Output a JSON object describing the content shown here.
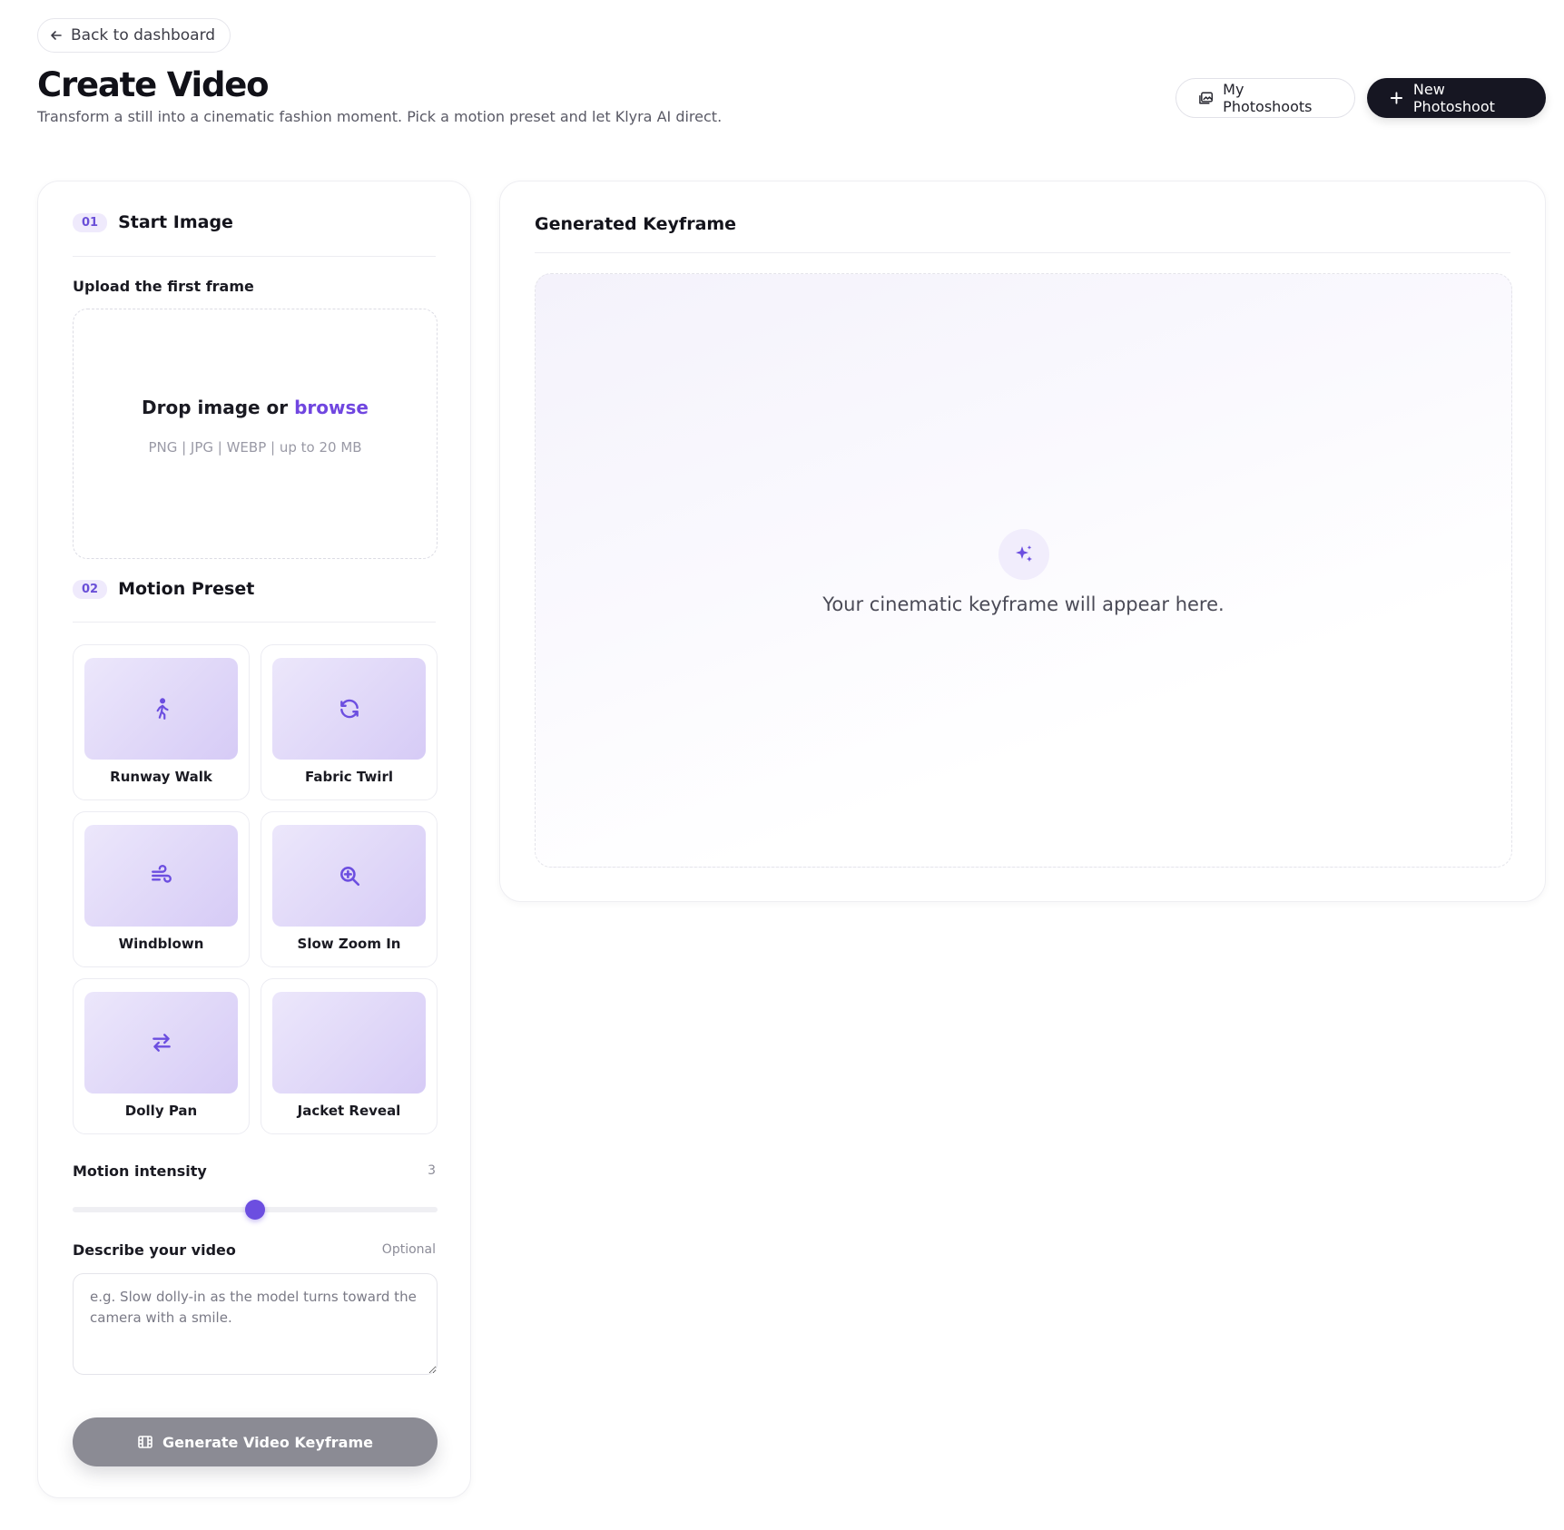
{
  "header": {
    "back_label": "Back to dashboard",
    "title": "Create Video",
    "subtitle": "Transform a still into a cinematic fashion moment. Pick a motion preset and let Klyra AI direct.",
    "my_photoshoots_label": "My Photoshoots",
    "new_photoshoot_label": "New Photoshoot"
  },
  "start_image": {
    "step": "01",
    "title": "Start Image",
    "upload_label": "Upload the first frame",
    "drop_text": "Drop image or",
    "browse_text": "browse",
    "formats": "PNG | JPG | WEBP | up to 20 MB"
  },
  "motion_preset": {
    "step": "02",
    "title": "Motion Preset",
    "presets": [
      {
        "label": "Runway Walk",
        "icon": "walking-person-icon"
      },
      {
        "label": "Fabric Twirl",
        "icon": "refresh-icon"
      },
      {
        "label": "Windblown",
        "icon": "wind-icon"
      },
      {
        "label": "Slow Zoom In",
        "icon": "zoom-in-icon"
      },
      {
        "label": "Dolly Pan",
        "icon": "swap-arrows-icon"
      },
      {
        "label": "Jacket Reveal",
        "icon": ""
      }
    ]
  },
  "intensity": {
    "label": "Motion intensity",
    "value": "3",
    "level_fraction": 0.5
  },
  "description": {
    "label": "Describe your video",
    "optional_label": "Optional",
    "placeholder": "e.g. Slow dolly-in as the model turns toward the camera with a smile."
  },
  "generate_label": "Generate Video Keyframe",
  "keyframe": {
    "title": "Generated Keyframe",
    "empty_text": "Your cinematic keyframe will appear here."
  },
  "colors": {
    "accent": "#6c4ee0",
    "primary_button": "#161622",
    "disabled_button": "#8b8b94"
  }
}
